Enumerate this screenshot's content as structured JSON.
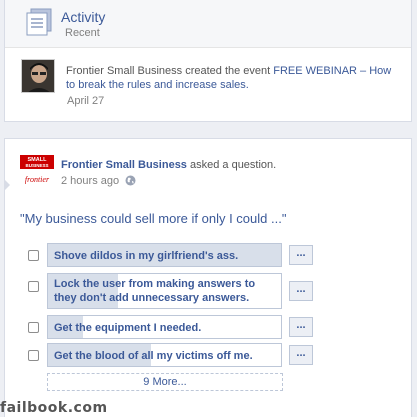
{
  "activity": {
    "title": "Activity",
    "subtitle": "Recent",
    "event_prefix": "Frontier Small Business created the event ",
    "event_link": "FREE WEBINAR – How to break the rules and increase sales.",
    "date": "April 27"
  },
  "question": {
    "page_name": "Frontier Small Business",
    "action": " asked a question.",
    "time": "2 hours ago",
    "prompt": "\"My business could sell more if only I could ...\"",
    "options": [
      {
        "label": "Shove dildos in my girlfriend's ass.",
        "fill": 1.0
      },
      {
        "label": "Lock the user from making answers to they don't add unnecessary answers.",
        "fill": 0.3
      },
      {
        "label": "Get the equipment I needed.",
        "fill": 0.15
      },
      {
        "label": "Get the blood of all my victims off me.",
        "fill": 0.44
      }
    ],
    "more_button_label": "...",
    "see_more": "9 More...",
    "logo_text_top": "SMALL",
    "logo_text_mid": "BUSINESS",
    "logo_text_brand": "frontier"
  },
  "watermark": "failbook.com",
  "icons": {
    "activity": "activity-list-icon",
    "globe": "globe-icon"
  },
  "colors": {
    "link": "#3b5998",
    "logo_red": "#cc0000"
  }
}
